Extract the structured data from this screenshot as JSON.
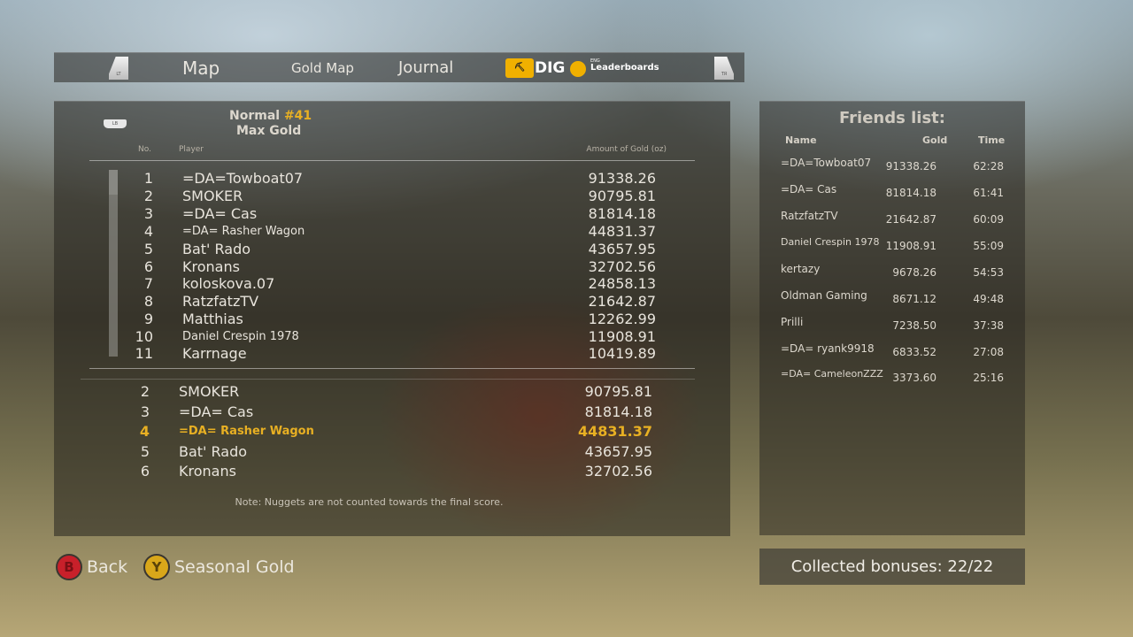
{
  "tabs": {
    "left_trigger": "LT",
    "right_trigger": "RT",
    "items": [
      "Map",
      "Gold Map",
      "Journal"
    ],
    "brand_badge": "⛏",
    "brand_text": "DIG",
    "lang": "ENG",
    "leaderboards": "Leaderboards"
  },
  "leaderboard": {
    "lb_button": "LB",
    "mode": "Normal",
    "mode_number": "#41",
    "subtitle": "Max Gold",
    "col_no": "No.",
    "col_player": "Player",
    "col_gold": "Amount of Gold (oz)",
    "rows": [
      {
        "no": "1",
        "player": "=DA=Towboat07",
        "gold": "91338.26"
      },
      {
        "no": "2",
        "player": "SMOKER",
        "gold": "90795.81"
      },
      {
        "no": "3",
        "player": "=DA= Cas",
        "gold": "81814.18"
      },
      {
        "no": "4",
        "player": "=DA= Rasher Wagon",
        "gold": "44831.37"
      },
      {
        "no": "5",
        "player": "Bat' Rado",
        "gold": "43657.95"
      },
      {
        "no": "6",
        "player": "Kronans",
        "gold": "32702.56"
      },
      {
        "no": "7",
        "player": "koloskova.07",
        "gold": "24858.13"
      },
      {
        "no": "8",
        "player": "RatzfatzTV",
        "gold": "21642.87"
      },
      {
        "no": "9",
        "player": "Matthias",
        "gold": "12262.99"
      },
      {
        "no": "10",
        "player": "Daniel Crespin 1978",
        "gold": "11908.91"
      },
      {
        "no": "11",
        "player": "Karrnage",
        "gold": "10419.89"
      }
    ],
    "nearby_rows": [
      {
        "no": "2",
        "player": "SMOKER",
        "gold": "90795.81"
      },
      {
        "no": "3",
        "player": "=DA= Cas",
        "gold": "81814.18"
      },
      {
        "no": "4",
        "player": "=DA= Rasher Wagon",
        "gold": "44831.37"
      },
      {
        "no": "5",
        "player": "Bat' Rado",
        "gold": "43657.95"
      },
      {
        "no": "6",
        "player": "Kronans",
        "gold": "32702.56"
      }
    ],
    "note": "Note: Nuggets are not counted towards the final score."
  },
  "friends": {
    "title": "Friends list:",
    "col_name": "Name",
    "col_gold": "Gold",
    "col_time": "Time",
    "rows": [
      {
        "name": "=DA=Towboat07",
        "gold": "91338.26",
        "time": "62:28"
      },
      {
        "name": "=DA= Cas",
        "gold": "81814.18",
        "time": "61:41"
      },
      {
        "name": "RatzfatzTV",
        "gold": "21642.87",
        "time": "60:09"
      },
      {
        "name": "Daniel Crespin 1978",
        "gold": "11908.91",
        "time": "55:09"
      },
      {
        "name": "kertazy",
        "gold": "9678.26",
        "time": "54:53"
      },
      {
        "name": "Oldman Gaming",
        "gold": "8671.12",
        "time": "49:48"
      },
      {
        "name": "Prilli",
        "gold": "7238.50",
        "time": "37:38"
      },
      {
        "name": "=DA= ryank9918",
        "gold": "6833.52",
        "time": "27:08"
      },
      {
        "name": "=DA= CameleonZZZ",
        "gold": "3373.60",
        "time": "25:16"
      }
    ]
  },
  "bonuses": "Collected bonuses: 22/22",
  "hints": {
    "back_key": "B",
    "back_label": "Back",
    "seasonal_key": "Y",
    "seasonal_label": "Seasonal Gold"
  },
  "colors": {
    "highlight": "#e8b023",
    "b_button": "#c8202a",
    "y_button": "#d9a71a"
  }
}
